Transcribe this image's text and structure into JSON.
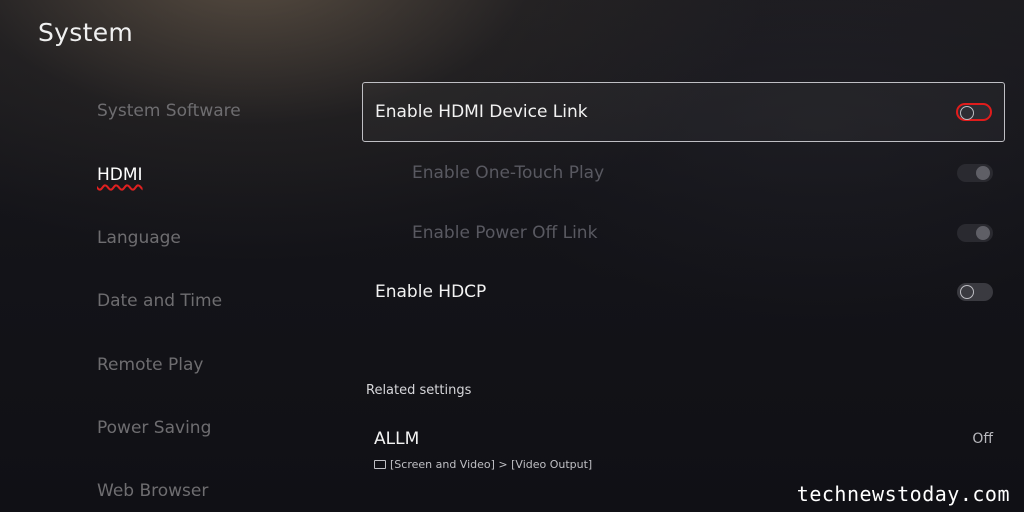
{
  "page_title": "System",
  "sidebar": {
    "items": [
      {
        "label": "System Software"
      },
      {
        "label": "HDMI"
      },
      {
        "label": "Language"
      },
      {
        "label": "Date and Time"
      },
      {
        "label": "Remote Play"
      },
      {
        "label": "Power Saving"
      },
      {
        "label": "Web Browser"
      }
    ]
  },
  "settings": {
    "rows": [
      {
        "label": "Enable HDMI Device Link",
        "state": "off"
      },
      {
        "label": "Enable One-Touch Play",
        "state": "on (disabled)"
      },
      {
        "label": "Enable Power Off Link",
        "state": "on (disabled)"
      },
      {
        "label": "Enable HDCP",
        "state": "off"
      }
    ]
  },
  "related": {
    "section_label": "Related settings",
    "allm_label": "ALLM",
    "allm_value": "Off",
    "allm_path": "[Screen and Video] > [Video Output]"
  },
  "watermark": "technewstoday.com",
  "colors": {
    "accent_red": "#e01c1c",
    "text_primary": "#f2f2f2",
    "text_dim": "#6e6d70"
  }
}
